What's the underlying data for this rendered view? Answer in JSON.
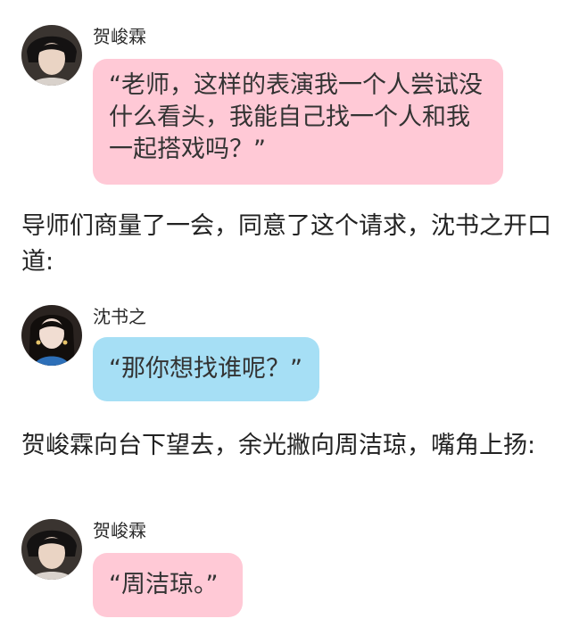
{
  "messages": [
    {
      "speaker": "贺峻霖",
      "text": "“老师，这样的表演我一个人尝试没什么看头，我能自己找一个人和我一起搭戏吗？”",
      "bubble_color": "#ffc9d6"
    },
    {
      "speaker": "沈书之",
      "text": "“那你想找谁呢？”",
      "bubble_color": "#a6dff5"
    },
    {
      "speaker": "贺峻霖",
      "text": "“周洁琼。”",
      "bubble_color": "#ffc9d6"
    }
  ],
  "narration": [
    "导师们商量了一会，同意了这个请求，沈书之开口道:",
    "贺峻霖向台下望去，余光撇向周洁琼，嘴角上扬:"
  ]
}
